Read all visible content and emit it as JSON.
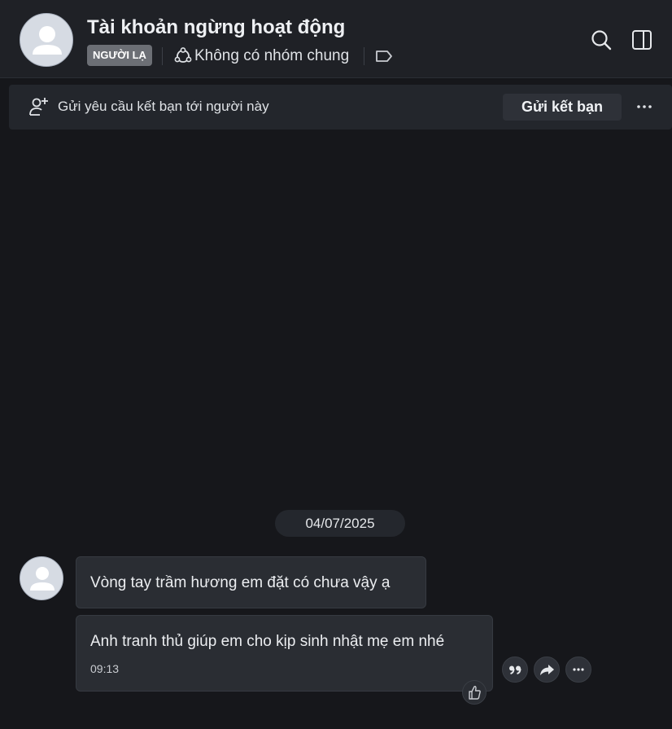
{
  "header": {
    "title": "Tài khoản ngừng hoạt động",
    "tag": "NGƯỜI LẠ",
    "group_info": "Không có nhóm chung"
  },
  "friend_request": {
    "text": "Gửi yêu cầu kết bạn tới người này",
    "button_label": "Gửi kết bạn"
  },
  "date_separator": "04/07/2025",
  "messages": [
    {
      "text": "Vòng tay trầm hương em đặt có chưa vậy ạ"
    },
    {
      "text": "Anh tranh thủ giúp em cho kịp sinh nhật mẹ em nhé",
      "time": "09:13"
    }
  ],
  "icons": {
    "avatar": "default-user-avatar",
    "group": "group-circle-icon",
    "label": "label-tag-icon",
    "search": "search-icon",
    "panel": "sidebar-panel-icon",
    "add_friend": "add-friend-icon",
    "more": "more-horizontal-icon",
    "quote": "quote-icon",
    "forward": "forward-icon",
    "like": "thumbs-up-icon"
  },
  "colors": {
    "background": "#16171b",
    "header_bg": "#1f2126",
    "bubble_bg": "#2a2d33",
    "tag_bg": "#6c6f75"
  }
}
